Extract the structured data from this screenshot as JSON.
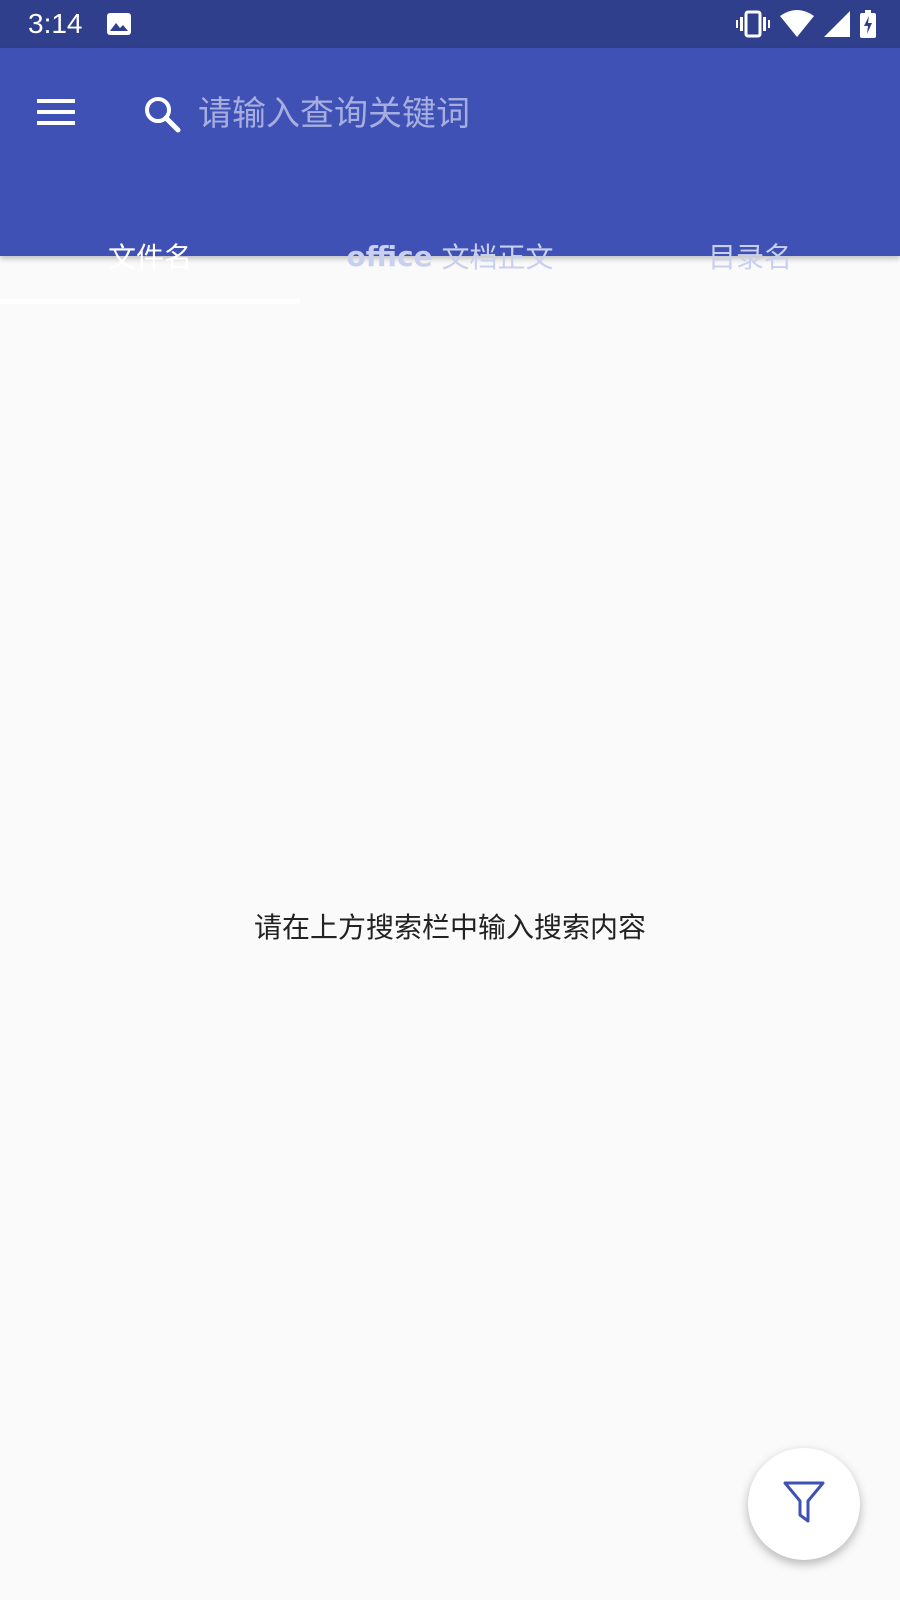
{
  "status_bar": {
    "time": "3:14",
    "icons": [
      "image-icon",
      "vibrate-icon",
      "wifi-icon",
      "cell-signal-icon",
      "battery-charging-icon"
    ]
  },
  "app_bar": {
    "menu_icon": "hamburger-menu-icon",
    "search": {
      "icon": "search-icon",
      "placeholder": "请输入查询关键词",
      "value": ""
    }
  },
  "tabs": [
    {
      "label": "文件名",
      "selected": true
    },
    {
      "label_prefix": "office",
      "label_suffix": " 文档正文",
      "selected": false
    },
    {
      "label": "目录名",
      "selected": false
    }
  ],
  "content": {
    "empty_message": "请在上方搜索栏中输入搜索内容"
  },
  "fab": {
    "icon": "filter-icon"
  },
  "colors": {
    "primary": "#3f51b5",
    "primary_dark": "#303f8c",
    "background": "#fafafa",
    "fab_icon": "#3f51b5"
  }
}
